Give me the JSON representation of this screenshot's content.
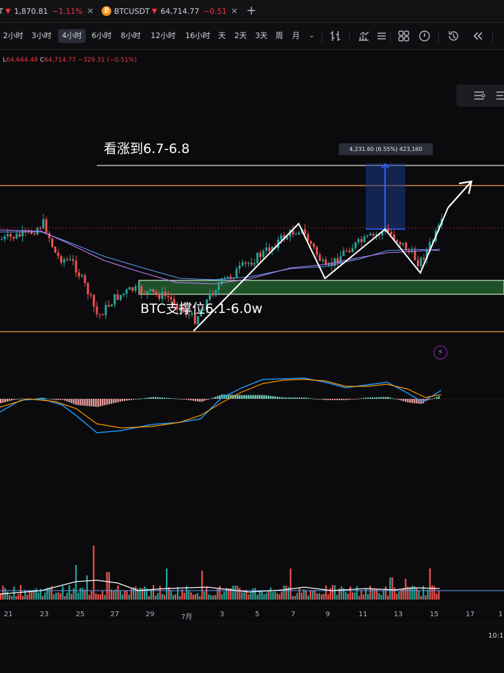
{
  "tabs": [
    {
      "symbol": "T",
      "price": "1,870.81",
      "change": "−1.11%"
    },
    {
      "symbol": "BTCUSDT",
      "price": "64,714.77",
      "change": "−0.51"
    }
  ],
  "timeframes": [
    "2小时",
    "3小时",
    "4小时",
    "6小时",
    "8小时",
    "12小时",
    "16小时",
    "天",
    "2天",
    "3天",
    "周",
    "月"
  ],
  "active_timeframe": "4小时",
  "toolbar_icons": [
    "chevron-down-icon",
    "bar-style-icon",
    "indicators-icon",
    "layout-icon",
    "alert-icon",
    "replay-icon",
    "rewind-icon"
  ],
  "legend": {
    "low_label": "L",
    "low": "64,644.48",
    "close_label": "C",
    "close": "64,714.77",
    "change": "−329.31 (−0.51%)"
  },
  "annotations": {
    "bullish_target": "看涨到6.7-6.8",
    "support": "BTC支撑位6.1-6.0w",
    "measure": "4,231.60 (6.55%) 423,160"
  },
  "time_axis": {
    "labels": [
      "21",
      "23",
      "25",
      "27",
      "29",
      "7月",
      "3",
      "5",
      "7",
      "9",
      "11",
      "13",
      "15",
      "17",
      "1"
    ],
    "clock": "10:1"
  },
  "colors": {
    "up": "#26a69a",
    "down": "#ef5350",
    "range_line": "#ff9f43",
    "support_zone": "#1e5128",
    "measure": "#2962ff"
  },
  "chart_data": {
    "type": "candlestick",
    "symbol": "BTCUSDT",
    "interval": "4小时",
    "price_range": [
      59800,
      69200
    ],
    "key_levels": {
      "upper_target": 68000,
      "resistance": 67000,
      "support_zone": [
        60900,
        61300
      ],
      "lower_support": 60000
    },
    "measure": {
      "from": 64700,
      "to": 68931.6,
      "change": 4231.6,
      "change_pct": 6.55
    },
    "path_points": [
      {
        "date": "7月2日",
        "price": 60200
      },
      {
        "date": "7月7日",
        "price": 64700
      },
      {
        "date": "7月9日",
        "price": 61300
      },
      {
        "date": "7月12日",
        "price": 64400
      },
      {
        "date": "7月14日",
        "price": 61400
      },
      {
        "date": "7月16日",
        "price": 67000
      }
    ],
    "indicators": [
      "MA",
      "MACD",
      "Volume"
    ]
  }
}
